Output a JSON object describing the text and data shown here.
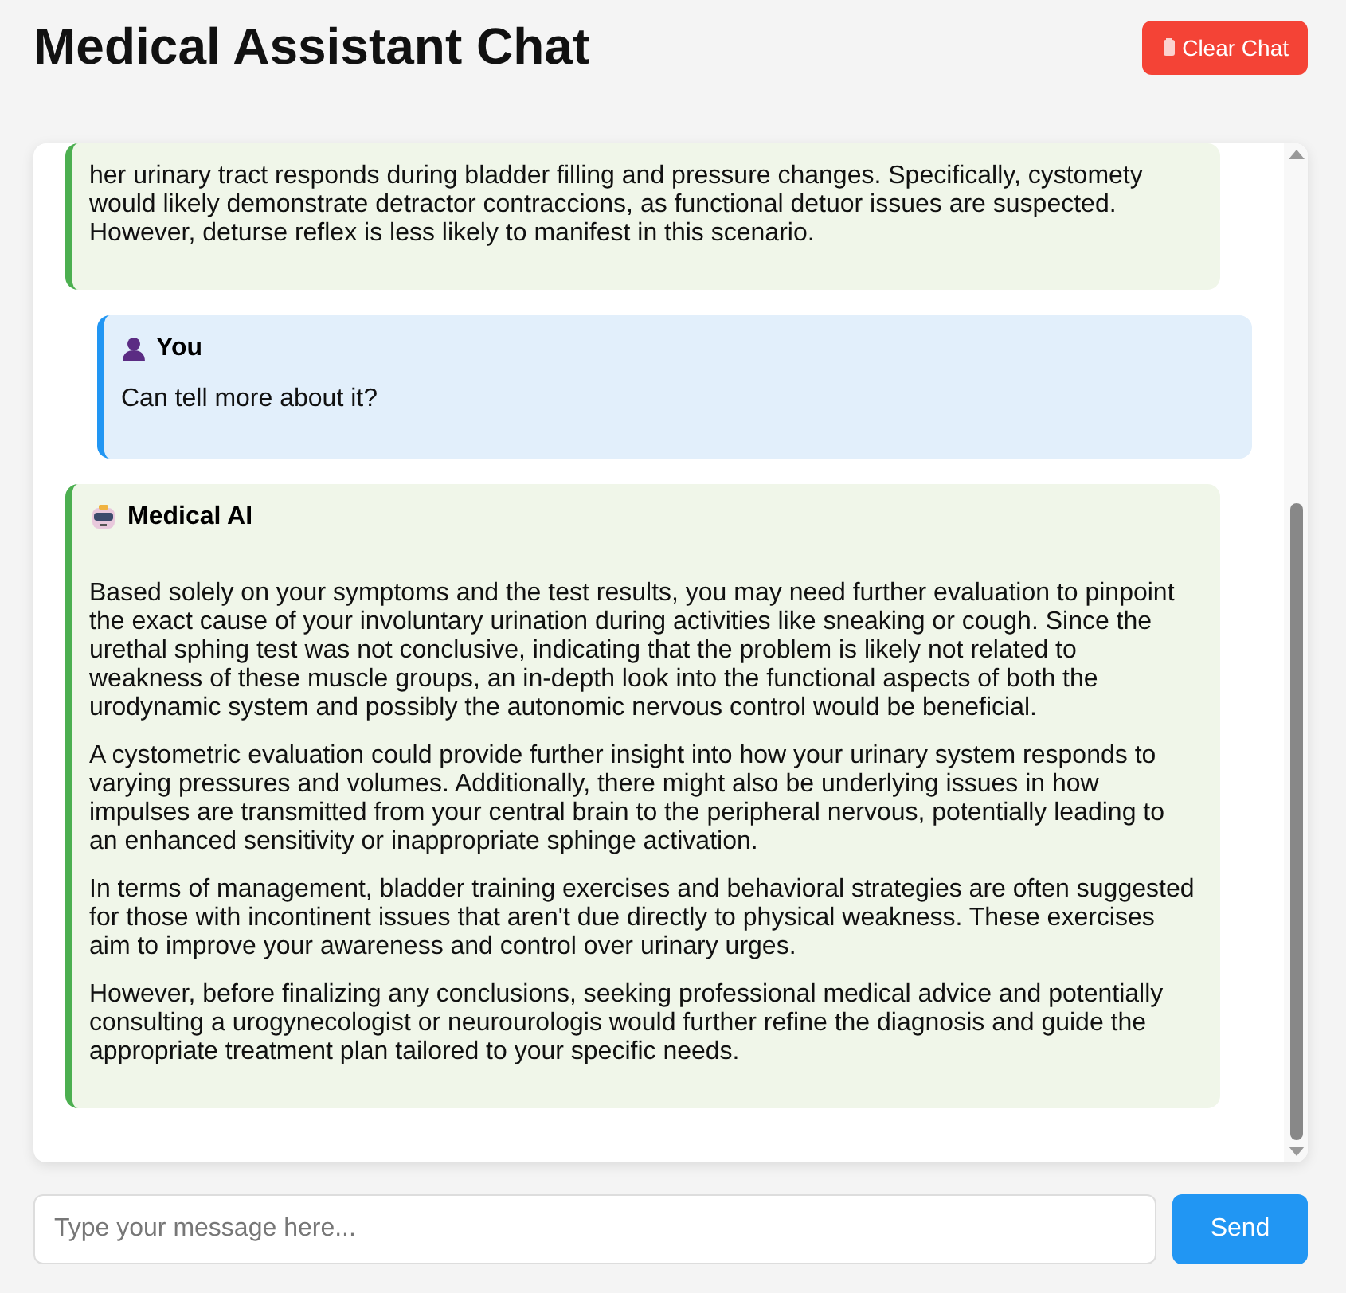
{
  "header": {
    "title": "Medical Assistant Chat",
    "clear_button": "Clear Chat"
  },
  "messages": [
    {
      "kind": "ai",
      "paragraphs": [
        "her urinary tract responds during bladder filling and pressure changes. Specifically, cystomety would likely demonstrate detractor contraccions, as functional detuor issues are suspected. However, deturse reflex is less likely to manifest in this scenario."
      ]
    },
    {
      "kind": "user",
      "sender": "You",
      "paragraphs": [
        "Can tell more about it?"
      ]
    },
    {
      "kind": "ai",
      "sender": "Medical AI",
      "paragraphs": [
        "Based solely on your symptoms and the test results, you may need further evaluation to pinpoint the exact cause of your involuntary urination during activities like sneaking or cough. Since the urethal sphing test was not conclusive, indicating that the problem is likely not related to weakness of these muscle groups, an in-depth look into the functional aspects of both the urodynamic system and possibly the autonomic nervous control would be beneficial.",
        "A cystometric evaluation could provide further insight into how your urinary system responds to varying pressures and volumes. Additionally, there might also be underlying issues in how impulses are transmitted from your central brain to the peripheral nervous, potentially leading to an enhanced sensitivity or inappropriate sphinge activation.",
        "In terms of management, bladder training exercises and behavioral strategies are often suggested for those with incontinent issues that aren't due directly to physical weakness. These exercises aim to improve your awareness and control over urinary urges.",
        "However, before finalizing any conclusions, seeking professional medical advice and potentially consulting a urogynecologist or neurourologis would further refine the diagnosis and guide the appropriate treatment plan tailored to your specific needs."
      ]
    }
  ],
  "composer": {
    "placeholder": "Type your message here...",
    "send_button": "Send"
  }
}
